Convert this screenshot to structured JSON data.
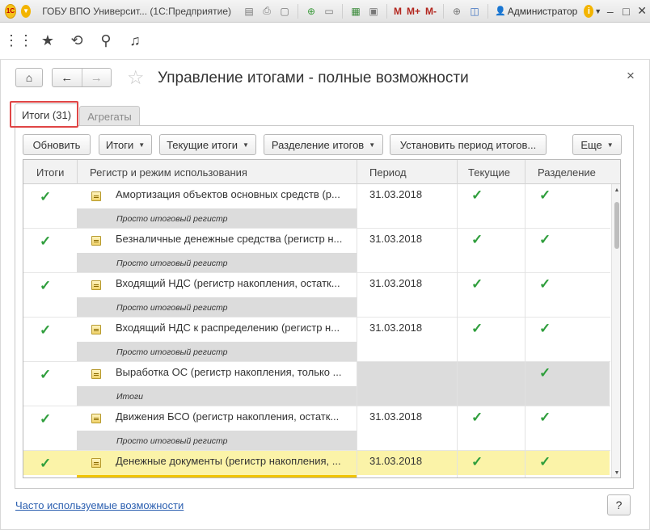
{
  "window": {
    "title": "ГОБУ ВПО Университ... (1С:Предприятие)",
    "logo_text": "1С",
    "user": "Администратор",
    "toolbar_m": [
      "M",
      "M+",
      "M-"
    ]
  },
  "form": {
    "title": "Управление итогами - полные возможности"
  },
  "tabs": [
    {
      "label": "Итоги (31)",
      "active": true
    },
    {
      "label": "Агрегаты",
      "active": false
    }
  ],
  "commands": {
    "refresh": "Обновить",
    "totals": "Итоги",
    "current_totals": "Текущие итоги",
    "split_totals": "Разделение итогов",
    "set_period": "Установить период итогов...",
    "more": "Еще"
  },
  "table": {
    "columns": [
      "Итоги",
      "Регистр и режим использования",
      "Период",
      "Текущие",
      "Разделение"
    ],
    "rows": [
      {
        "name": "Амортизация объектов основных средств (р...",
        "mode": "Просто итоговый регистр",
        "period": "31.03.2018",
        "totals": true,
        "current": true,
        "split": true
      },
      {
        "name": "Безналичные денежные средства (регистр н...",
        "mode": "Просто итоговый регистр",
        "period": "31.03.2018",
        "totals": true,
        "current": true,
        "split": true
      },
      {
        "name": "Входящий НДС (регистр накопления, остатк...",
        "mode": "Просто итоговый регистр",
        "period": "31.03.2018",
        "totals": true,
        "current": true,
        "split": true
      },
      {
        "name": "Входящий НДС к распределению (регистр н...",
        "mode": "Просто итоговый регистр",
        "period": "31.03.2018",
        "totals": true,
        "current": true,
        "split": true
      },
      {
        "name": "Выработка ОС (регистр накопления, только ...",
        "mode": "Итоги",
        "period": "",
        "totals": true,
        "current": false,
        "split": true
      },
      {
        "name": "Движения БСО (регистр накопления, остатк...",
        "mode": "Просто итоговый регистр",
        "period": "31.03.2018",
        "totals": true,
        "current": true,
        "split": true
      },
      {
        "name": "Денежные документы (регистр накопления, ...",
        "mode": "",
        "period": "31.03.2018",
        "totals": true,
        "current": true,
        "split": true,
        "selected": true
      }
    ]
  },
  "footer": {
    "link": "Часто используемые возможности",
    "help": "?"
  },
  "colors": {
    "check": "#2f9e3c",
    "selected_row": "#fbf3a8",
    "link": "#2b5fb0",
    "highlight_frame": "#e04545"
  }
}
